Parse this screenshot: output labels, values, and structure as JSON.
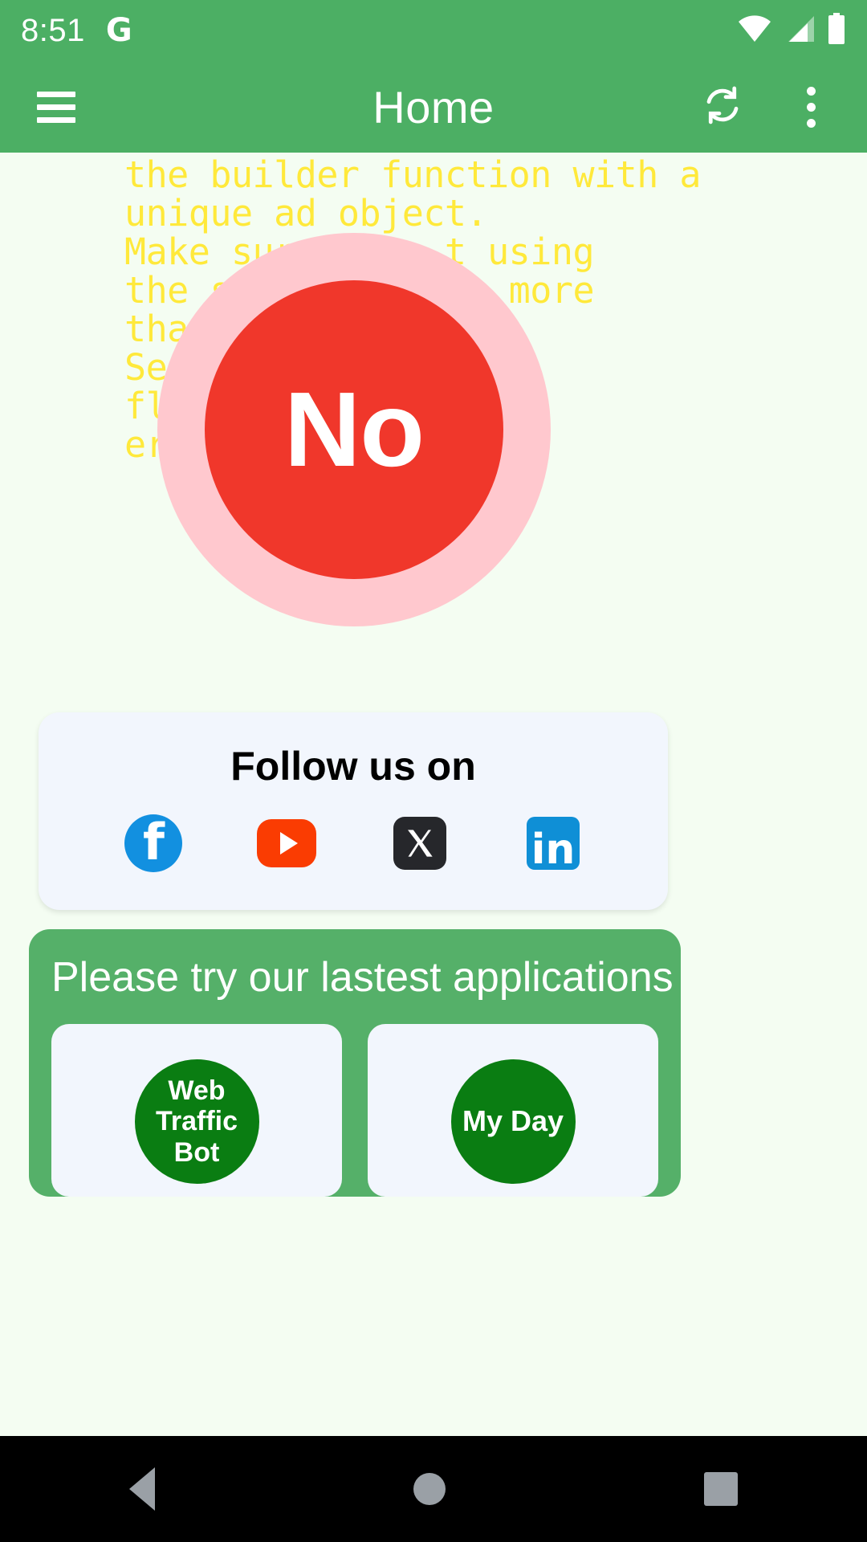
{
  "status_bar": {
    "time": "8:51",
    "google_glyph": "G",
    "icons": [
      "wifi-icon",
      "cellular-signal-icon",
      "battery-icon"
    ]
  },
  "app_bar": {
    "menu_icon": "hamburger-menu-icon",
    "title": "Home",
    "refresh_icon": "sync-refresh-icon",
    "overflow_icon": "more-vertical-icon"
  },
  "debug_text": "create a new instance in\nthe builder function with a\nunique ad object.\nMake sure      t using\nthe sa            more\nthan\nSee\nflu\ner",
  "no_button": {
    "label": "No",
    "halo_color": "#FFC8CE",
    "fill_color": "#F0372B",
    "text_color": "#FFFFFF"
  },
  "follow_card": {
    "title": "Follow us on",
    "socials": [
      {
        "name": "facebook-icon",
        "glyph": "f",
        "color": "#1290E0"
      },
      {
        "name": "youtube-icon",
        "glyph": "▶",
        "color": "#FA3C02"
      },
      {
        "name": "x-twitter-icon",
        "glyph": "𝕏",
        "color": "#26272B"
      },
      {
        "name": "linkedin-icon",
        "glyph": "in",
        "color": "#0F8FD6"
      }
    ]
  },
  "apps_card": {
    "title": "Please try our lastest applications",
    "background": "#55B069",
    "apps": [
      {
        "name": "Web Traffic Bot",
        "circle_color": "#0A7D12"
      },
      {
        "name": "My Day",
        "circle_color": "#0A7D12"
      }
    ]
  },
  "nav_bar": {
    "back_icon": "back-triangle-icon",
    "home_icon": "home-circle-icon",
    "recents_icon": "recents-square-icon"
  },
  "colors": {
    "brand_green": "#4CAF64",
    "page_background": "#F4FDF2",
    "debug_text_color": "#FFE93B"
  }
}
